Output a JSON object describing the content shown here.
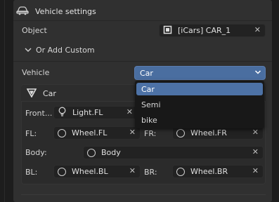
{
  "header": {
    "title": "Vehicle settings"
  },
  "object": {
    "label": "Object",
    "value": "[iCars] CAR_1"
  },
  "custom": {
    "label": "Or Add Custom"
  },
  "vehicle": {
    "label": "Vehicle",
    "selected": "Car"
  },
  "dropdown": {
    "options": [
      "Car",
      "Semi",
      "bike"
    ]
  },
  "car_section": {
    "title": "Car",
    "front_label": "Front...",
    "front_value": "Light.FL",
    "fl_label": "FL:",
    "fl_value": "Wheel.FL",
    "fr_label": "FR:",
    "fr_value": "Wheel.FR",
    "body_label": "Body:",
    "body_value": "Body",
    "bl_label": "BL:",
    "bl_value": "Wheel.BL",
    "br_label": "BR:",
    "br_value": "Wheel.BR"
  },
  "icons": [
    "car-icon",
    "object-box-icon",
    "chevron-down-icon",
    "funnel-icon",
    "light-bulb-icon",
    "circle-object-icon",
    "clear-x-icon"
  ],
  "colors": {
    "selected_blue": "#4a6ea0",
    "panel": "#303030",
    "background": "#1d1d1d"
  }
}
